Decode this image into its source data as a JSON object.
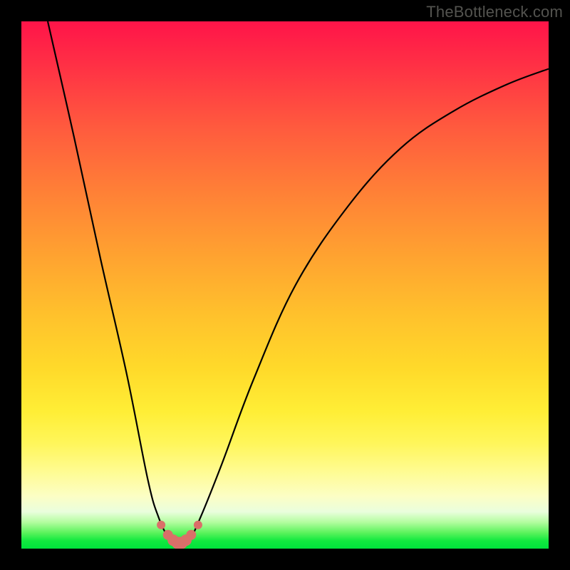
{
  "watermark": "TheBottleneck.com",
  "chart_data": {
    "type": "line",
    "title": "",
    "xlabel": "",
    "ylabel": "",
    "xlim": [
      0,
      100
    ],
    "ylim": [
      0,
      100
    ],
    "grid": false,
    "legend": false,
    "series": [
      {
        "name": "bottleneck-curve",
        "x": [
          5,
          10,
          15,
          20,
          24,
          26,
          28,
          30,
          32,
          34,
          38,
          44,
          52,
          62,
          72,
          82,
          92,
          100
        ],
        "values": [
          100,
          78,
          55,
          33,
          13,
          6,
          2,
          1,
          2,
          6,
          16,
          32,
          50,
          65,
          76,
          83,
          88,
          91
        ],
        "stroke": "#000000",
        "stroke_width": 2.2
      }
    ],
    "markers": {
      "name": "valley-markers",
      "x": [
        26.5,
        27.8,
        28.8,
        29.6,
        30.0,
        30.4,
        31.2,
        32.2,
        33.5
      ],
      "values": [
        4.5,
        2.6,
        1.6,
        1.1,
        1.0,
        1.1,
        1.6,
        2.6,
        4.5
      ],
      "radii": [
        6,
        7,
        8,
        8.5,
        9,
        8.5,
        8,
        7,
        6
      ],
      "fill": "#da6f69"
    },
    "background_gradient": {
      "stops": [
        {
          "pos": 0.0,
          "color": "#ff1449"
        },
        {
          "pos": 0.08,
          "color": "#ff2f45"
        },
        {
          "pos": 0.2,
          "color": "#ff5a3e"
        },
        {
          "pos": 0.33,
          "color": "#ff8236"
        },
        {
          "pos": 0.45,
          "color": "#ffa430"
        },
        {
          "pos": 0.56,
          "color": "#ffc22c"
        },
        {
          "pos": 0.66,
          "color": "#ffda2a"
        },
        {
          "pos": 0.74,
          "color": "#ffee36"
        },
        {
          "pos": 0.8,
          "color": "#fff65a"
        },
        {
          "pos": 0.85,
          "color": "#fffb8e"
        },
        {
          "pos": 0.9,
          "color": "#fcfec4"
        },
        {
          "pos": 0.93,
          "color": "#eafedd"
        },
        {
          "pos": 0.95,
          "color": "#b3fd9f"
        },
        {
          "pos": 0.97,
          "color": "#5bf35c"
        },
        {
          "pos": 0.985,
          "color": "#12e93f"
        },
        {
          "pos": 1.0,
          "color": "#00e23c"
        }
      ]
    }
  }
}
